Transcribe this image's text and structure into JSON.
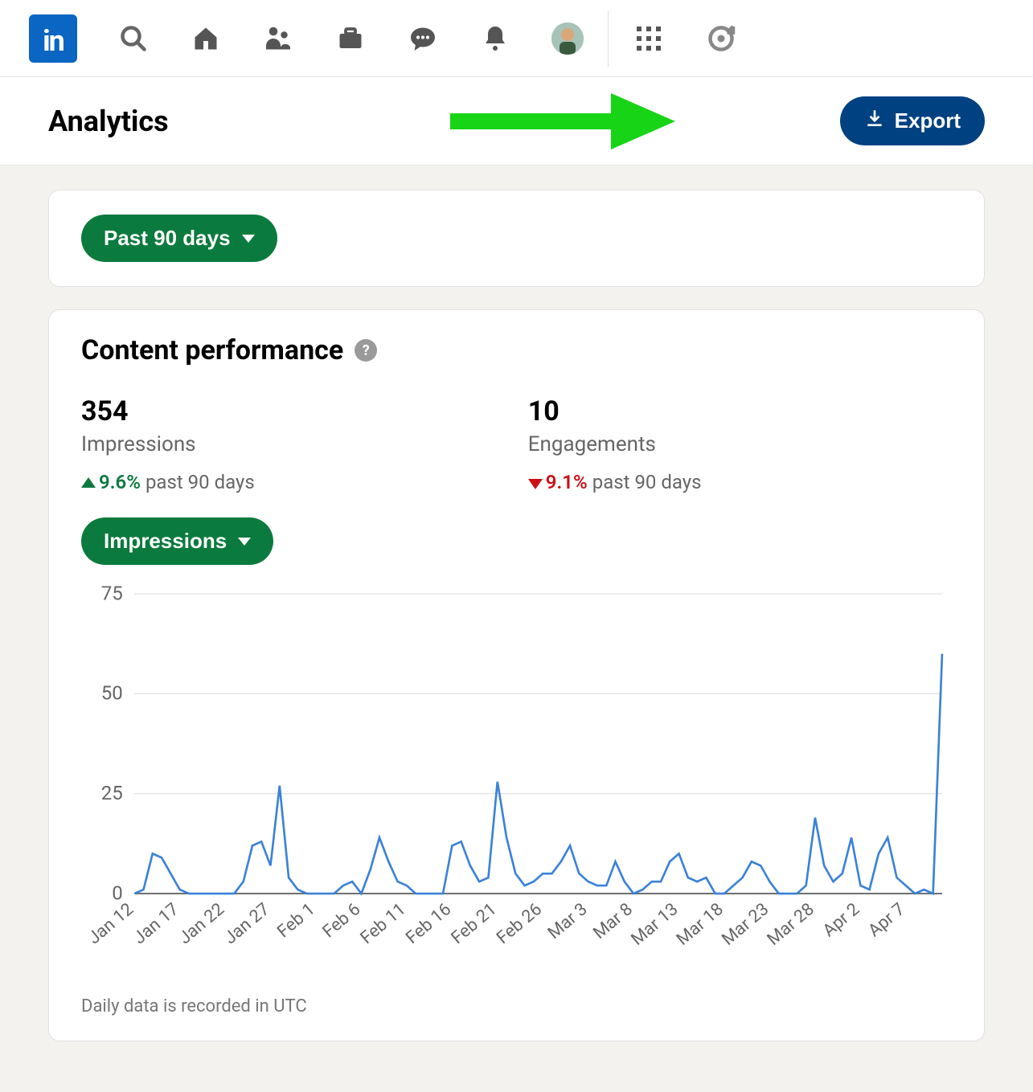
{
  "nav": {
    "logo_text": "in"
  },
  "header": {
    "title": "Analytics",
    "export_label": "Export"
  },
  "date_filter": {
    "label": "Past 90 days"
  },
  "content_perf": {
    "title": "Content performance",
    "impressions": {
      "value": "354",
      "label": "Impressions",
      "change_pct": "9.6%",
      "change_dir": "up",
      "period": "past 90 days"
    },
    "engagements": {
      "value": "10",
      "label": "Engagements",
      "change_pct": "9.1%",
      "change_dir": "down",
      "period": "past 90 days"
    },
    "metric_selector": {
      "label": "Impressions"
    },
    "footnote": "Daily data is recorded in UTC"
  },
  "chart_data": {
    "type": "line",
    "title": "Impressions",
    "xlabel": "",
    "ylabel": "",
    "ylim": [
      0,
      75
    ],
    "y_ticks": [
      0,
      25,
      50,
      75
    ],
    "x_tick_labels": [
      "Jan 12",
      "Jan 17",
      "Jan 22",
      "Jan 27",
      "Feb 1",
      "Feb 6",
      "Feb 11",
      "Feb 16",
      "Feb 21",
      "Feb 26",
      "Mar 3",
      "Mar 8",
      "Mar 13",
      "Mar 18",
      "Mar 23",
      "Mar 28",
      "Apr 2",
      "Apr 7"
    ],
    "values": [
      0,
      1,
      10,
      9,
      5,
      1,
      0,
      0,
      0,
      0,
      0,
      0,
      3,
      12,
      13,
      7,
      27,
      4,
      1,
      0,
      0,
      0,
      0,
      2,
      3,
      0,
      6,
      14,
      8,
      3,
      2,
      0,
      0,
      0,
      0,
      12,
      13,
      7,
      3,
      4,
      28,
      14,
      5,
      2,
      3,
      5,
      5,
      8,
      12,
      5,
      3,
      2,
      2,
      8,
      3,
      0,
      1,
      3,
      3,
      8,
      10,
      4,
      3,
      4,
      0,
      0,
      2,
      4,
      8,
      7,
      3,
      0,
      0,
      0,
      2,
      19,
      7,
      3,
      5,
      14,
      2,
      1,
      10,
      14,
      4,
      2,
      0,
      1,
      0,
      60
    ]
  }
}
